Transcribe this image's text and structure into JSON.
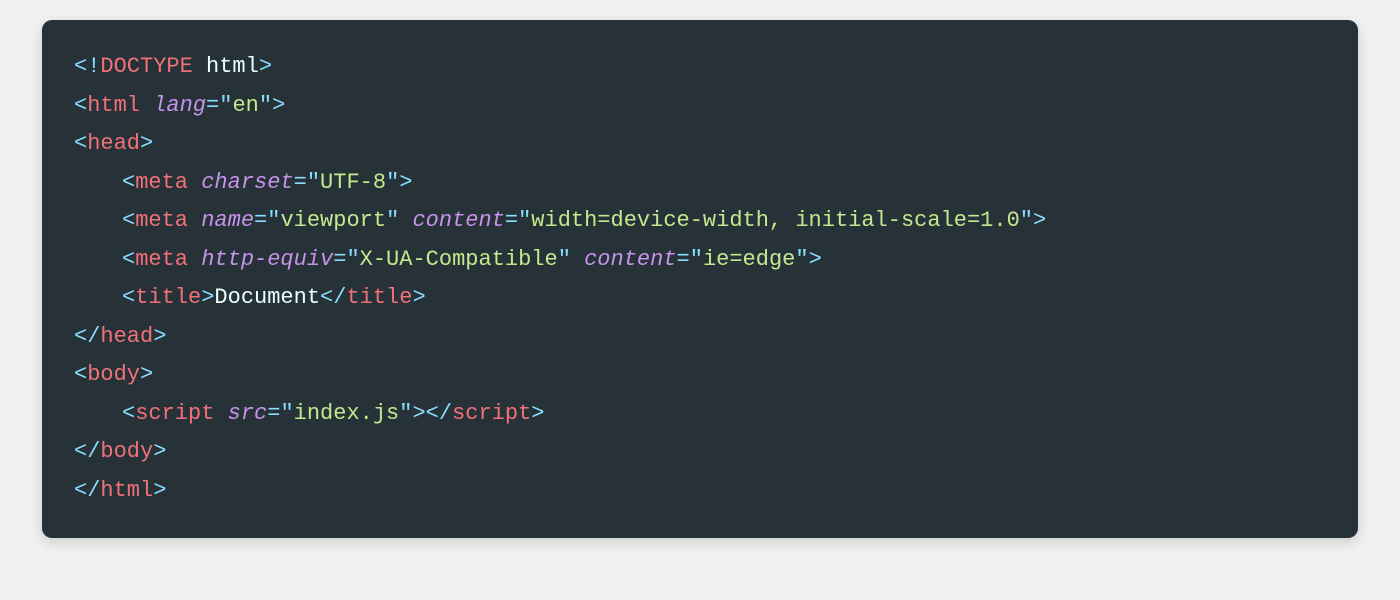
{
  "tokens": {
    "lt": "<",
    "gt": ">",
    "slash": "/",
    "eq": "=",
    "bang": "!",
    "qopen": "\"",
    "qclose": "\""
  },
  "doctype": {
    "name": "DOCTYPE",
    "kind": "html"
  },
  "tags": {
    "html": "html",
    "head": "head",
    "meta": "meta",
    "title": "title",
    "body": "body",
    "script": "script"
  },
  "attrs": {
    "lang": "lang",
    "charset": "charset",
    "name": "name",
    "content": "content",
    "http_equiv": "http-equiv",
    "src": "src"
  },
  "values": {
    "lang": "en",
    "charset": "UTF-8",
    "viewport_name": "viewport",
    "viewport_content": "width=device-width, initial-scale=1.0",
    "http_equiv": "X-UA-Compatible",
    "ie_edge": "ie=edge",
    "title_text": "Document",
    "script_src": "index.js"
  }
}
